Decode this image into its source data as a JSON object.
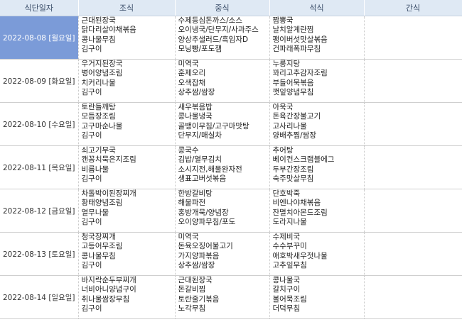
{
  "headers": [
    "식단일자",
    "조식",
    "중식",
    "석식",
    "간식"
  ],
  "rows": [
    {
      "date": "2022-08-08 [월요일]",
      "breakfast": [
        "근대된장국",
        "닭다리살야채볶음",
        "콩나물무침",
        "김구이"
      ],
      "lunch": [
        "수제등심돈까스/소스",
        "오이냉국/단무지/사과주스",
        "양상추샐러드/흑임자D",
        "모닝빵/포도잼"
      ],
      "dinner": [
        "짬뽕국",
        "날치알계란찜",
        "팽이버섯맛살볶음",
        "건파래폭파무침"
      ],
      "snack": []
    },
    {
      "date": "2022-08-09 [화요일]",
      "breakfast": [
        "우거지된장국",
        "병어양념조림",
        "치커리나물",
        "김구이"
      ],
      "lunch": [
        "미역국",
        "훈제오리",
        "오색잡채",
        "상추쌈/쌈장"
      ],
      "dinner": [
        "누룽지탕",
        "꽈리고추감자조림",
        "부들어묵볶음",
        "깻잎양념무침"
      ],
      "snack": []
    },
    {
      "date": "2022-08-10 [수요일]",
      "breakfast": [
        "토란들깨탕",
        "모듬장조림",
        "고구마순나물",
        "김구이"
      ],
      "lunch": [
        "새우볶음밥",
        "콩나물냉국",
        "골뱅이무침/고구마맛탕",
        "단무지/매실차"
      ],
      "dinner": [
        "아욱국",
        "돈육간장불고기",
        "고사리나물",
        "양배추찜/쌈장"
      ],
      "snack": []
    },
    {
      "date": "2022-08-11 [목요일]",
      "breakfast": [
        "쇠고기무국",
        "캔꽁치묵은지조림",
        "비름나물",
        "김구이"
      ],
      "lunch": [
        "콩국수",
        "김밥/열무김치",
        "소시지전,해물완자전",
        "생표고버섯볶음"
      ],
      "dinner": [
        "추어탕",
        "베이컨스크램블에그",
        "두부간장조림",
        "숙주맛살무침"
      ],
      "snack": []
    },
    {
      "date": "2022-08-12 [금요일]",
      "breakfast": [
        "차돌박이된장찌개",
        "황태양념조림",
        "열무나물",
        "김구이"
      ],
      "lunch": [
        "한방갈비탕",
        "해물파전",
        "홍방개묵/양념장",
        "오이양파무침/포도"
      ],
      "dinner": [
        "단호박죽",
        "비엔나야채볶음",
        "잔멸치아몬드조림",
        "도라지나물"
      ],
      "snack": []
    },
    {
      "date": "2022-08-13 [토요일]",
      "breakfast": [
        "청국장찌개",
        "고등어무조림",
        "콩나물무침",
        "김구이"
      ],
      "lunch": [
        "미역국",
        "돈육오징어불고기",
        "가지양파볶음",
        "상추쌈/쌈장"
      ],
      "dinner": [
        "수제비국",
        "수수부꾸미",
        "애호박새우젓나물",
        "고추잎무침"
      ],
      "snack": []
    },
    {
      "date": "2022-08-14 [일요일]",
      "breakfast": [
        "바지락순두부찌개",
        "너비아니양념구이",
        "취나물쌈장무침",
        "김구이"
      ],
      "lunch": [
        "근대된장국",
        "돈갈비찜",
        "토란줄기볶음",
        "노각무침"
      ],
      "dinner": [
        "콩나물국",
        "갈치구이",
        "볼어묵조림",
        "더덕무침"
      ],
      "snack": []
    }
  ]
}
